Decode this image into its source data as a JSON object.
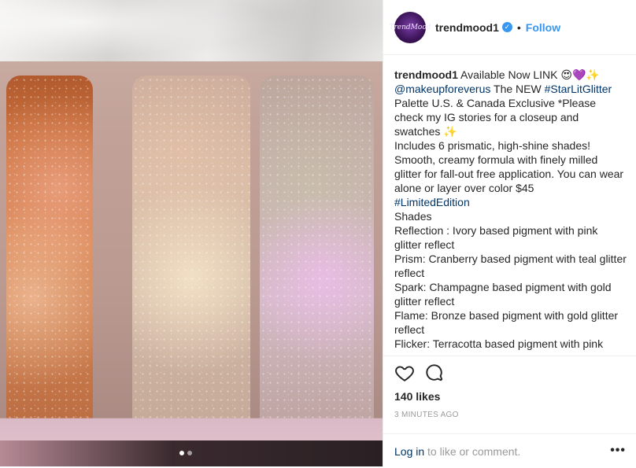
{
  "post": {
    "username": "trendmood1",
    "avatar_text": "TrendMood",
    "separator": "•",
    "follow_label": "Follow",
    "verified_glyph": "✓"
  },
  "caption": {
    "username": "trendmood1",
    "line1_text": "Available Now LINK 😍💜✨",
    "mention": "@makeupforeverus",
    "line2_text": "The NEW",
    "hashtag1": "#StarLitGlitter",
    "line3": "Palette U.S. & Canada Exclusive *Please check my IG stories for a closeup and swatches ✨",
    "line4": "Includes 6 prismatic, high-shine shades! Smooth, creamy formula with finely milled glitter for fall-out free application. You can wear alone or layer over color $45",
    "hashtag2": "#LimitedEdition",
    "shades_heading": "Shades",
    "shades": [
      "Reflection : Ivory based pigment with pink glitter reflect",
      "Prism: Cranberry based pigment with teal glitter reflect",
      "Spark: Champagne based pigment with gold glitter reflect",
      "Flame: Bronze based pigment with gold glitter reflect",
      "Flicker: Terracotta based pigment with pink glitter reflect"
    ]
  },
  "stats": {
    "likes": "140 likes",
    "time": "3 MINUTES AGO"
  },
  "comment": {
    "login_label": "Log in",
    "rest_text": "to like or comment.",
    "more_label": "•••"
  },
  "carousel": {
    "count": 2,
    "active": 0
  },
  "colors": {
    "accent": "#3897f0",
    "link": "#003569",
    "muted": "#999999"
  }
}
